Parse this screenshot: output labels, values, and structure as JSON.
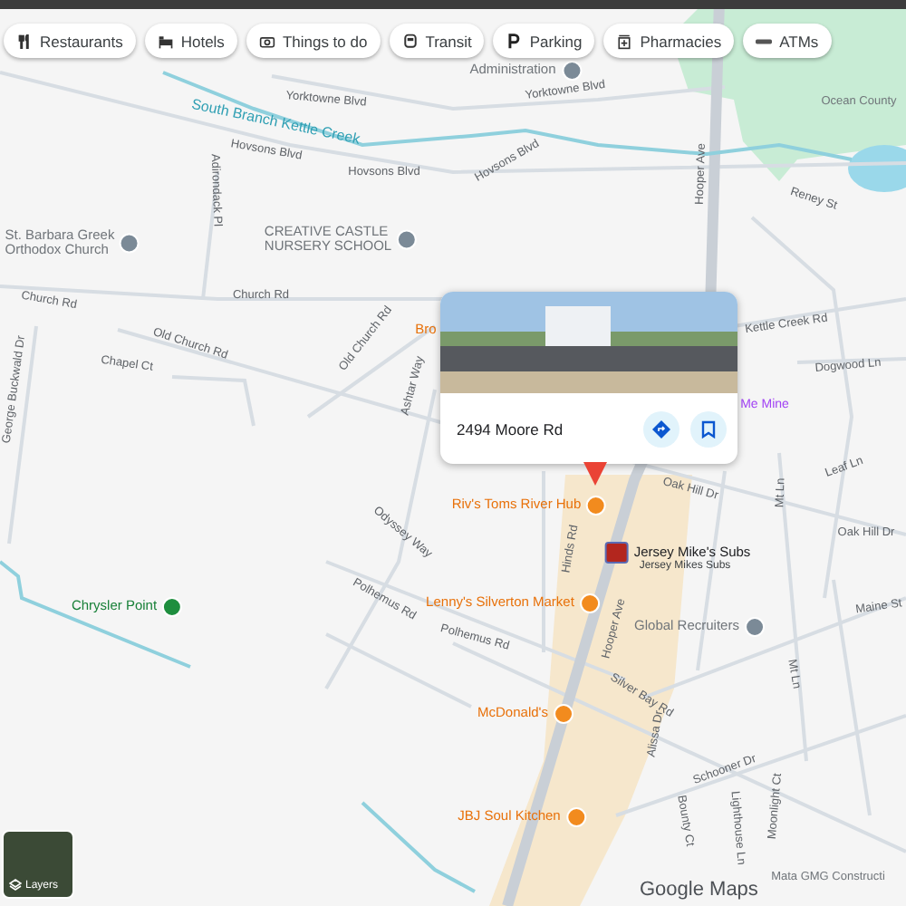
{
  "chips": [
    {
      "kind": "restaurants",
      "label": "Restaurants"
    },
    {
      "kind": "hotels",
      "label": "Hotels"
    },
    {
      "kind": "things",
      "label": "Things to do"
    },
    {
      "kind": "transit",
      "label": "Transit"
    },
    {
      "kind": "parking",
      "label": "Parking"
    },
    {
      "kind": "pharmacies",
      "label": "Pharmacies"
    },
    {
      "kind": "atms",
      "label": "ATMs"
    }
  ],
  "labels": [
    {
      "kind": "place",
      "text": "Administration"
    },
    {
      "kind": "street",
      "text": "Yorktowne Blvd"
    },
    {
      "kind": "street",
      "text": "Yorktowne Blvd"
    },
    {
      "kind": "water",
      "text": "South Branch Kettle Creek"
    },
    {
      "kind": "street",
      "text": "Hovsons Blvd"
    },
    {
      "kind": "street",
      "text": "Hovsons Blvd"
    },
    {
      "kind": "street",
      "text": "Hovsons Blvd"
    },
    {
      "kind": "area",
      "text": "Ocean County"
    },
    {
      "kind": "street",
      "text": "Hooper Ave"
    },
    {
      "kind": "street",
      "text": "Reney St"
    },
    {
      "kind": "street",
      "text": "Adirondack Pl"
    },
    {
      "kind": "place",
      "text": "St. Barbara Greek\nOrthodox Church"
    },
    {
      "kind": "place",
      "text": "CREATIVE CASTLE\nNURSERY SCHOOL"
    },
    {
      "kind": "street",
      "text": "Church Rd"
    },
    {
      "kind": "street",
      "text": "Church Rd"
    },
    {
      "kind": "street",
      "text": "Old Church Rd"
    },
    {
      "kind": "street",
      "text": "Old Church Rd"
    },
    {
      "kind": "street",
      "text": "Chapel Ct"
    },
    {
      "kind": "street",
      "text": "George Buckwald Dr"
    },
    {
      "kind": "street",
      "text": "Ashtar Way"
    },
    {
      "kind": "food_text",
      "text": "Bro"
    },
    {
      "kind": "street",
      "text": "Kettle Creek Rd"
    },
    {
      "kind": "street",
      "text": "Dogwood Ln"
    },
    {
      "kind": "store",
      "text": "Me Mine"
    },
    {
      "kind": "street",
      "text": "Leaf Ln"
    },
    {
      "kind": "street",
      "text": "Mt Ln"
    },
    {
      "kind": "street",
      "text": "Oak Hill Dr"
    },
    {
      "kind": "street",
      "text": "Oak Hill Dr"
    },
    {
      "kind": "street",
      "text": "Odyssey Way"
    },
    {
      "kind": "street",
      "text": "Polhemus Rd"
    },
    {
      "kind": "street",
      "text": "Polhemus Rd"
    },
    {
      "kind": "park",
      "text": "Chrysler Point"
    },
    {
      "kind": "food",
      "text": "Riv's Toms River Hub"
    },
    {
      "kind": "brand",
      "text": "Jersey Mike's Subs"
    },
    {
      "kind": "brand_sub",
      "text": "Jersey Mikes Subs"
    },
    {
      "kind": "food",
      "text": "Lenny's Silverton Market"
    },
    {
      "kind": "street",
      "text": "Hinds Rd"
    },
    {
      "kind": "street",
      "text": "Hooper Ave"
    },
    {
      "kind": "place",
      "text": "Global Recruiters"
    },
    {
      "kind": "street",
      "text": "Maine St"
    },
    {
      "kind": "street",
      "text": "Mt Ln"
    },
    {
      "kind": "street",
      "text": "Silver Bay Rd"
    },
    {
      "kind": "food",
      "text": "McDonald's"
    },
    {
      "kind": "street",
      "text": "Alissa Dr"
    },
    {
      "kind": "street",
      "text": "Schooner Dr"
    },
    {
      "kind": "street",
      "text": "Bounty Ct"
    },
    {
      "kind": "street",
      "text": "Lighthouse Ln"
    },
    {
      "kind": "street",
      "text": "Moonlight Ct"
    },
    {
      "kind": "food",
      "text": "JBJ Soul Kitchen"
    },
    {
      "kind": "area",
      "text": "Mata GMG Constructi"
    }
  ],
  "place_card": {
    "address": "2494 Moore Rd"
  },
  "layers_button": {
    "label": "Layers"
  },
  "logo": "Google Maps"
}
